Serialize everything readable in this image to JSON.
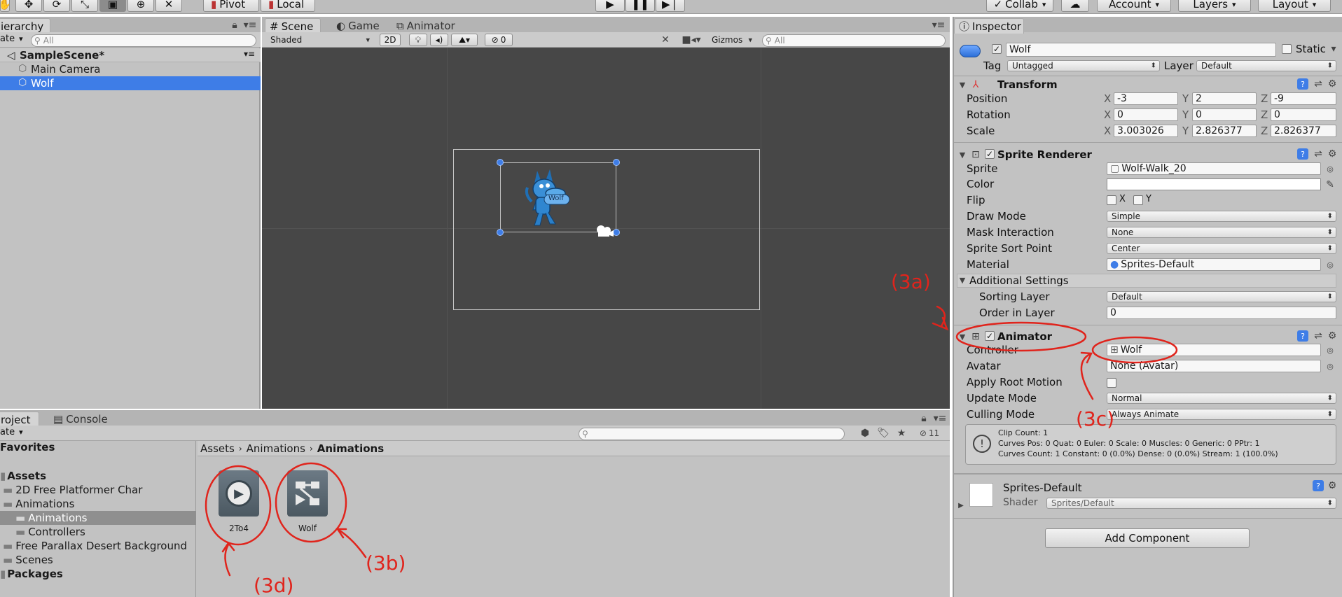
{
  "toolbar": {
    "pivot": "Pivot",
    "local": "Local",
    "collab": "Collab",
    "account": "Account",
    "layers": "Layers",
    "layout": "Layout"
  },
  "hierarchy": {
    "tab": "ierarchy",
    "create": "ate",
    "search_placeholder": "All",
    "scene": "SampleScene*",
    "items": [
      "Main Camera",
      "Wolf"
    ]
  },
  "scene_view": {
    "tabs": [
      "Scene",
      "Game",
      "Animator"
    ],
    "shading": "Shaded",
    "mode_2d": "2D",
    "hidden_count": "0",
    "gizmos": "Gizmos",
    "search_placeholder": "All",
    "sprite_label": "Wolf"
  },
  "project": {
    "tabs": [
      "roject",
      "Console"
    ],
    "create": "ate",
    "hidden_count": "11",
    "tree": {
      "favorites": "Favorites",
      "assets": "Assets",
      "folders": [
        "2D Free Platformer Char",
        "Animations",
        "Animations",
        "Controllers",
        "Free Parallax Desert Background",
        "Scenes"
      ],
      "packages": "Packages"
    },
    "breadcrumb": [
      "Assets",
      "Animations",
      "Animations"
    ],
    "assets": [
      {
        "name": "2To4",
        "icon": "animation-clip-icon"
      },
      {
        "name": "Wolf",
        "icon": "animator-controller-icon"
      }
    ]
  },
  "inspector": {
    "tab": "Inspector",
    "object_name": "Wolf",
    "static_label": "Static",
    "tag_label": "Tag",
    "tag_value": "Untagged",
    "layer_label": "Layer",
    "layer_value": "Default",
    "transform": {
      "title": "Transform",
      "rows": [
        {
          "label": "Position",
          "x": "-3",
          "y": "2",
          "z": "-9"
        },
        {
          "label": "Rotation",
          "x": "0",
          "y": "0",
          "z": "0"
        },
        {
          "label": "Scale",
          "x": "3.003026",
          "y": "2.826377",
          "z": "2.826377"
        }
      ],
      "axes": [
        "X",
        "Y",
        "Z"
      ]
    },
    "sprite_renderer": {
      "title": "Sprite Renderer",
      "sprite_label": "Sprite",
      "sprite_value": "Wolf-Walk_20",
      "color_label": "Color",
      "flip_label": "Flip",
      "flip_x": "X",
      "flip_y": "Y",
      "draw_mode_label": "Draw Mode",
      "draw_mode_value": "Simple",
      "mask_label": "Mask Interaction",
      "mask_value": "None",
      "sort_point_label": "Sprite Sort Point",
      "sort_point_value": "Center",
      "material_label": "Material",
      "material_value": "Sprites-Default",
      "additional": "Additional Settings",
      "sorting_layer_label": "Sorting Layer",
      "sorting_layer_value": "Default",
      "order_label": "Order in Layer",
      "order_value": "0"
    },
    "animator": {
      "title": "Animator",
      "controller_label": "Controller",
      "controller_value": "Wolf",
      "avatar_label": "Avatar",
      "avatar_value": "None (Avatar)",
      "root_motion_label": "Apply Root Motion",
      "update_label": "Update Mode",
      "update_value": "Normal",
      "culling_label": "Culling Mode",
      "culling_value": "Always Animate",
      "info": [
        "Clip Count: 1",
        "Curves Pos: 0 Quat: 0 Euler: 0 Scale: 0 Muscles: 0 Generic: 0 PPtr: 1",
        "Curves Count: 1 Constant: 0 (0.0%) Dense: 0 (0.0%) Stream: 1 (100.0%)"
      ]
    },
    "material": {
      "name": "Sprites-Default",
      "shader_label": "Shader",
      "shader_value": "Sprites/Default"
    },
    "add_component": "Add Component"
  },
  "annotations": {
    "a": "(3a)",
    "b": "(3b)",
    "c": "(3c)",
    "d": "(3d)"
  },
  "colors": {
    "panel": "#c2c2c2",
    "scene_bg": "#474747",
    "selection": "#3e7de7",
    "annotation": "#e0241c"
  }
}
